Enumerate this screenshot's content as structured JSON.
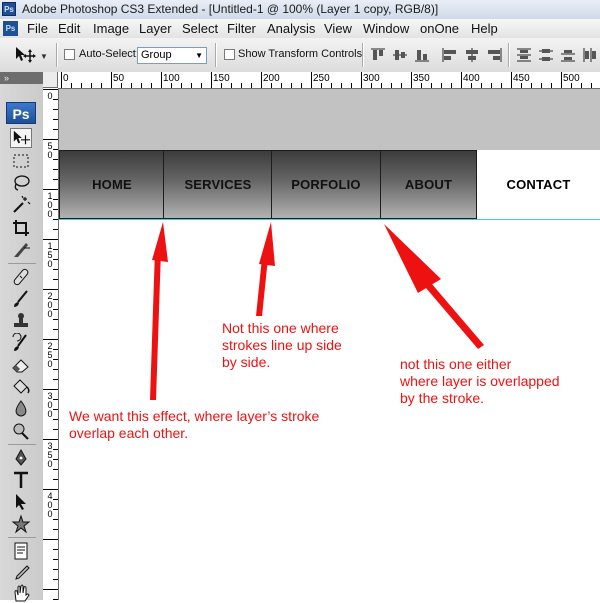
{
  "titlebar": {
    "title": "Adobe Photoshop CS3 Extended - [Untitled-1 @ 100% (Layer 1 copy, RGB/8)]"
  },
  "menubar": {
    "logo": "Ps",
    "items": [
      "File",
      "Edit",
      "Image",
      "Layer",
      "Select",
      "Filter",
      "Analysis",
      "View",
      "Window",
      "onOne",
      "Help"
    ]
  },
  "options_bar": {
    "auto_select_label": "Auto-Select:",
    "auto_select_checked": false,
    "group_value": "Group",
    "show_transform_label": "Show Transform Controls",
    "show_transform_checked": false
  },
  "tool_panel": {
    "logo": "Ps",
    "collapse": "»"
  },
  "ruler_top": [
    "0",
    "50",
    "100",
    "150",
    "200",
    "250",
    "300",
    "350",
    "400",
    "450",
    "500"
  ],
  "ruler_left": [
    "0",
    "5 0",
    "1 0 0",
    "1 5 0",
    "2 0 0",
    "2 5 0",
    "3 0 0",
    "3 5 0",
    "4 0 0"
  ],
  "nav": {
    "items": [
      "HOME",
      "SERVICES",
      "PORFOLIO",
      "ABOUT",
      "CONTACT"
    ]
  },
  "annotations": {
    "note1": [
      "We want this effect, where layer’s stroke",
      "overlap each other."
    ],
    "note2": [
      "Not this one where",
      "strokes line up side",
      "by side."
    ],
    "note3": [
      "not this one either",
      "where layer is overlapped",
      "by the stroke."
    ]
  },
  "colors": {
    "annotation": "#ee1111",
    "guide": "#39d3d3",
    "header_band": "#c2c2c2"
  }
}
